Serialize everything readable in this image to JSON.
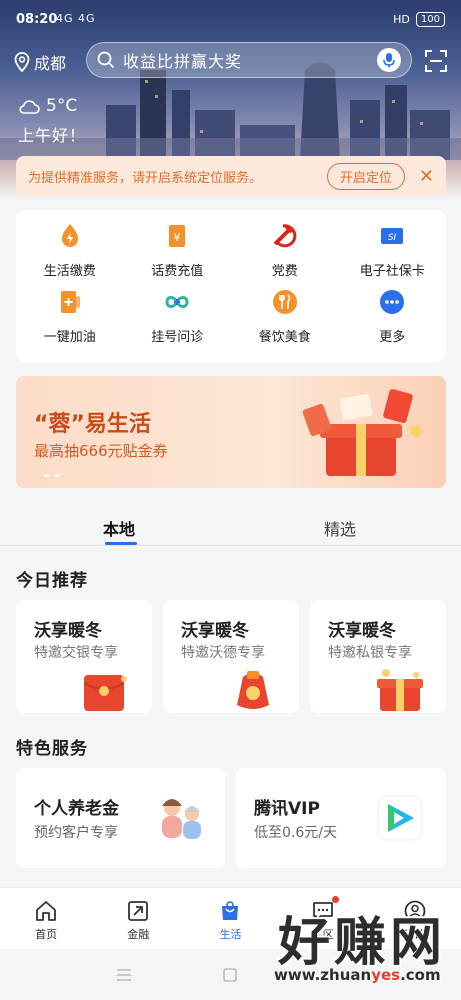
{
  "status_bar": {
    "time": "08:20",
    "signal": "4G 4G",
    "right_icons": "HD",
    "battery": "100"
  },
  "topbar": {
    "city": "成都",
    "search_placeholder": "收益比拼赢大奖"
  },
  "weather": {
    "temperature": "5°C",
    "greeting": "上午好！"
  },
  "location_banner": {
    "text": "为提供精准服务，请开启系统定位服务。",
    "button": "开启定位"
  },
  "services": [
    {
      "label": "生活缴费",
      "icon": "bolt-icon",
      "color": "#f3922b"
    },
    {
      "label": "话费充值",
      "icon": "yen-card-icon",
      "color": "#f3922b"
    },
    {
      "label": "党费",
      "icon": "party-emblem-icon",
      "color": "#d9261c"
    },
    {
      "label": "电子社保卡",
      "icon": "social-security-icon",
      "color": "#2b6ee8"
    },
    {
      "label": "一键加油",
      "icon": "fuel-icon",
      "color": "#f3922b"
    },
    {
      "label": "挂号问诊",
      "icon": "medical-icon",
      "color": "#2eb3a2"
    },
    {
      "label": "餐饮美食",
      "icon": "food-icon",
      "color": "#f3922b"
    },
    {
      "label": "更多",
      "icon": "more-icon",
      "color": "#2b6ee8"
    }
  ],
  "promo": {
    "title": "“蓉”易生活",
    "subtitle": "最高抽666元贴金券"
  },
  "tabs": [
    {
      "label": "本地",
      "active": true
    },
    {
      "label": "精选",
      "active": false
    }
  ],
  "today": {
    "title": "今日推荐",
    "cards": [
      {
        "title": "沃享暖冬",
        "subtitle": "特邀交银专享"
      },
      {
        "title": "沃享暖冬",
        "subtitle": "特邀沃德专享"
      },
      {
        "title": "沃享暖冬",
        "subtitle": "特邀私银专享"
      }
    ]
  },
  "featured": {
    "title": "特色服务",
    "cards": [
      {
        "title": "个人养老金",
        "subtitle": "预约客户专享"
      },
      {
        "title": "腾讯VIP",
        "subtitle": "低至0.6元/天"
      }
    ]
  },
  "bottom_nav": [
    {
      "label": "首页",
      "icon": "home-icon",
      "active": false
    },
    {
      "label": "金融",
      "icon": "finance-icon",
      "active": false
    },
    {
      "label": "生活",
      "icon": "shopping-bag-icon",
      "active": true
    },
    {
      "label": "社区",
      "icon": "chat-icon",
      "active": false,
      "badge": true
    },
    {
      "label": "我的",
      "icon": "profile-icon",
      "active": false
    }
  ],
  "watermark": {
    "text": "好赚网",
    "url_prefix": "www.zhuan",
    "url_accent": "yes",
    "url_suffix": ".com"
  }
}
